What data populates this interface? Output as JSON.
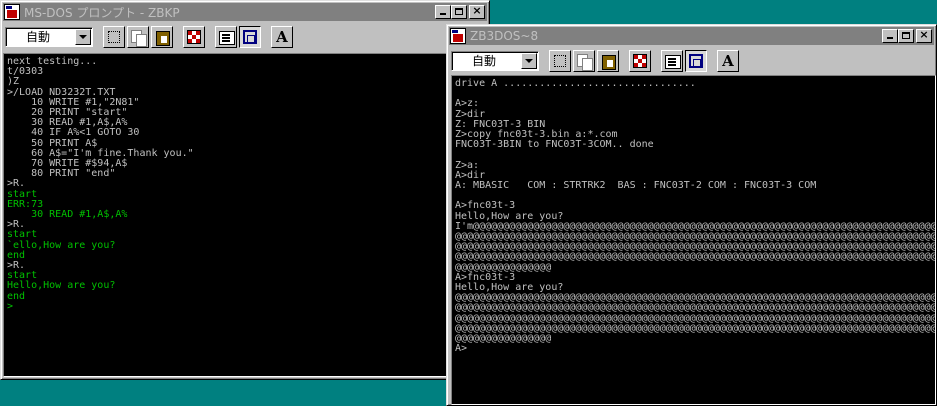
{
  "windows": [
    {
      "title": "MS-DOS プロンプト - ZBKP",
      "font_select": "自動",
      "lines": [
        {
          "text": "next testing...",
          "color": "white"
        },
        {
          "text": "t/0303",
          "color": "white"
        },
        {
          "text": ")Z",
          "color": "white"
        },
        {
          "text": ">/LOAD ND3232T.TXT",
          "color": "white"
        },
        {
          "text": "    10 WRITE #1,\"2N81\"",
          "color": "white"
        },
        {
          "text": "    20 PRINT \"start\"",
          "color": "white"
        },
        {
          "text": "    30 READ #1,A$,A%",
          "color": "white"
        },
        {
          "text": "    40 IF A%<1 GOTO 30",
          "color": "white"
        },
        {
          "text": "    50 PRINT A$",
          "color": "white"
        },
        {
          "text": "    60 A$=\"I'm fine.Thank you.\"",
          "color": "white"
        },
        {
          "text": "    70 WRITE #$94,A$",
          "color": "white"
        },
        {
          "text": "    80 PRINT \"end\"",
          "color": "white"
        },
        {
          "text": ">R.",
          "color": "white"
        },
        {
          "text": "start",
          "color": "green"
        },
        {
          "text": "ERR:73",
          "color": "green"
        },
        {
          "text": "    30 READ #1,A$,A%",
          "color": "green"
        },
        {
          "text": ">R.",
          "color": "white"
        },
        {
          "text": "start",
          "color": "green"
        },
        {
          "text": "`ello,How are you?",
          "color": "green"
        },
        {
          "text": "end",
          "color": "green"
        },
        {
          "text": ">R.",
          "color": "white"
        },
        {
          "text": "start",
          "color": "green"
        },
        {
          "text": "Hello,How are you?",
          "color": "green"
        },
        {
          "text": "end",
          "color": "green"
        },
        {
          "text": ">",
          "color": "green"
        }
      ]
    },
    {
      "title": "ZB3DOS~8",
      "font_select": "自動",
      "lines": [
        {
          "text": "drive A ................................",
          "color": "white"
        },
        {
          "text": "",
          "color": "white"
        },
        {
          "text": "A>z:",
          "color": "white"
        },
        {
          "text": "Z>dir",
          "color": "white"
        },
        {
          "text": "Z: FNC03T-3 BIN",
          "color": "white"
        },
        {
          "text": "Z>copy fnc03t-3.bin a:*.com",
          "color": "white"
        },
        {
          "text": "FNC03T-3BIN to FNC03T-3COM.. done",
          "color": "white"
        },
        {
          "text": "",
          "color": "white"
        },
        {
          "text": "Z>a:",
          "color": "white"
        },
        {
          "text": "A>dir",
          "color": "white"
        },
        {
          "text": "A: MBASIC   COM : STRTRK2  BAS : FNC03T-2 COM : FNC03T-3 COM",
          "color": "white"
        },
        {
          "text": "",
          "color": "white"
        },
        {
          "text": "A>fnc03t-3",
          "color": "white"
        },
        {
          "text": "Hello,How are you?",
          "color": "white"
        },
        {
          "text": "I'm@@@@@@@@@@@@@@@@@@@@@@@@@@@@@@@@@@@@@@@@@@@@@@@@@@@@@@@@@@@@@@@@@@@@@@@@@@@@@",
          "color": "white"
        },
        {
          "text": "@@@@@@@@@@@@@@@@@@@@@@@@@@@@@@@@@@@@@@@@@@@@@@@@@@@@@@@@@@@@@@@@@@@@@@@@@@@@@@@@",
          "color": "white"
        },
        {
          "text": "@@@@@@@@@@@@@@@@@@@@@@@@@@@@@@@@@@@@@@@@@@@@@@@@@@@@@@@@@@@@@@@@@@@@@@@@@@@@@@@@",
          "color": "white"
        },
        {
          "text": "@@@@@@@@@@@@@@@@@@@@@@@@@@@@@@@@@@@@@@@@@@@@@@@@@@@@@@@@@@@@@@@@@@@@@@@@@@@@@@@@",
          "color": "white"
        },
        {
          "text": "@@@@@@@@@@@@@@@@",
          "color": "white"
        },
        {
          "text": "A>fnc03t-3",
          "color": "white"
        },
        {
          "text": "Hello,How are you?",
          "color": "white"
        },
        {
          "text": "@@@@@@@@@@@@@@@@@@@@@@@@@@@@@@@@@@@@@@@@@@@@@@@@@@@@@@@@@@@@@@@@@@@@@@@@@@@@@@@@",
          "color": "white"
        },
        {
          "text": "@@@@@@@@@@@@@@@@@@@@@@@@@@@@@@@@@@@@@@@@@@@@@@@@@@@@@@@@@@@@@@@@@@@@@@@@@@@@@@@@",
          "color": "white"
        },
        {
          "text": "@@@@@@@@@@@@@@@@@@@@@@@@@@@@@@@@@@@@@@@@@@@@@@@@@@@@@@@@@@@@@@@@@@@@@@@@@@@@@@@@",
          "color": "white"
        },
        {
          "text": "@@@@@@@@@@@@@@@@@@@@@@@@@@@@@@@@@@@@@@@@@@@@@@@@@@@@@@@@@@@@@@@@@@@@@@@@@@@@@@@@",
          "color": "white"
        },
        {
          "text": "@@@@@@@@@@@@@@@@",
          "color": "white"
        },
        {
          "text": "A>",
          "color": "white"
        }
      ]
    }
  ],
  "colors": {
    "desktop": "#008080",
    "inactive_titlebar": "#808080",
    "console_text": "#c0c0c0",
    "console_green": "#00c000"
  }
}
